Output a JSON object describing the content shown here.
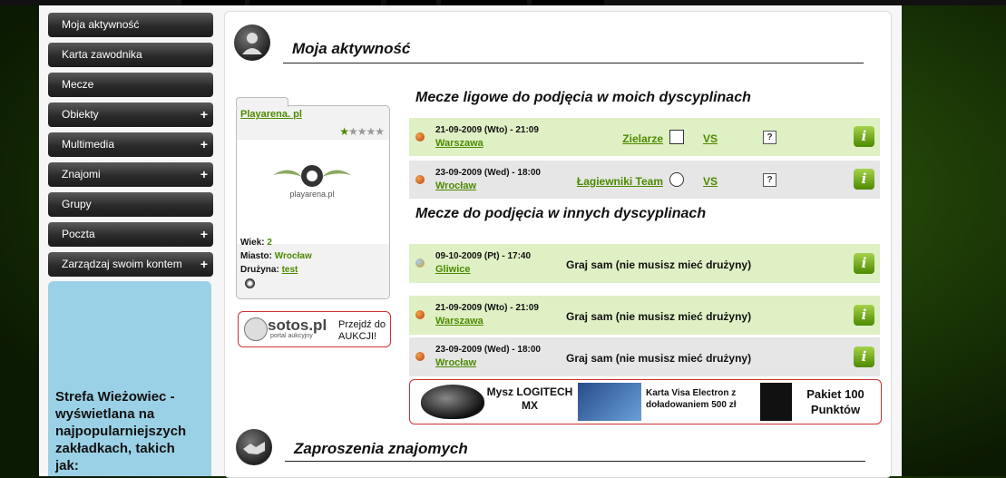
{
  "menu": [
    {
      "label": "Moja aktywność",
      "plus": ""
    },
    {
      "label": "Karta zawodnika",
      "plus": ""
    },
    {
      "label": "Mecze",
      "plus": ""
    },
    {
      "label": "Obiekty",
      "plus": "+"
    },
    {
      "label": "Multimedia",
      "plus": "+"
    },
    {
      "label": "Znajomi",
      "plus": "+"
    },
    {
      "label": "Grupy",
      "plus": ""
    },
    {
      "label": "Poczta",
      "plus": "+"
    },
    {
      "label": "Zarządzaj swoim kontem",
      "plus": "+"
    }
  ],
  "strefa_text": "Strefa Wieżowiec - wyświetlana na najpopularniejszych zakładkach, takich jak:",
  "activity_title": "Moja aktywność",
  "invites_title": "Zaproszenia znajomych",
  "profile": {
    "name": "Playarena. pl",
    "rating": "1 of 5",
    "logo_text": "playarena.pl",
    "age_label": "Wiek:",
    "age": "2",
    "city_label": "Miasto:",
    "city": "Wrocław",
    "team_label": "Drużyna:",
    "team": "test"
  },
  "sotos": {
    "brand": "sotos.pl",
    "sub": "portal aukcyjny",
    "cta": "Przejdź do AUKCJI!"
  },
  "league_heading": "Mecze ligowe do podjęcia w moich dyscyplinach",
  "league_matches": [
    {
      "date": "21-09-2009 (Wto) - 21:09",
      "city": "Warszawa",
      "team": "Zielarze",
      "vs": "VS",
      "q": "?",
      "info": "i"
    },
    {
      "date": "23-09-2009 (Wed) - 18:00",
      "city": "Wrocław",
      "team": "Łagiewniki Team",
      "vs": "VS",
      "q": "?",
      "info": "i"
    }
  ],
  "other_heading": "Mecze do podjęcia w innych dyscyplinach",
  "other_matches": [
    {
      "date": "09-10-2009 (Pt) - 17:40",
      "city": "Gliwice",
      "text": "Graj sam (nie musisz mieć drużyny)",
      "info": "i"
    },
    {
      "date": "21-09-2009 (Wto) - 21:09",
      "city": "Warszawa",
      "text": "Graj sam (nie musisz mieć drużyny)",
      "info": "i"
    },
    {
      "date": "23-09-2009 (Wed) - 18:00",
      "city": "Wrocław",
      "text": "Graj sam (nie musisz mieć drużyny)",
      "info": "i"
    }
  ],
  "ads": {
    "mouse": "Mysz LOGITECH MX",
    "card": "Karta Visa Electron z doładowaniem 500 zł",
    "points": "Pakiet 100 Punktów"
  }
}
